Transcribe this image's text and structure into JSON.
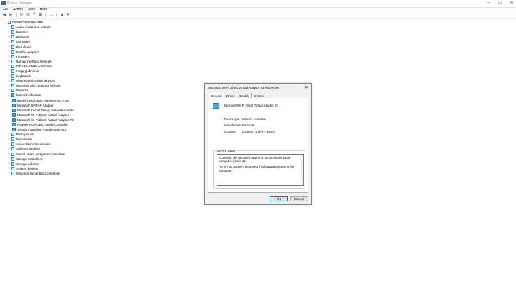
{
  "window": {
    "title": "Device Manager",
    "controls": [
      "–",
      "☐",
      "✕"
    ]
  },
  "menu": [
    "File",
    "Action",
    "View",
    "Help"
  ],
  "toolbar_icons": [
    "back-icon",
    "forward-icon",
    "properties-icon",
    "help-icon",
    "scan-icon",
    "monitor-icon",
    "update-driver-icon",
    "uninstall-icon"
  ],
  "tree": {
    "root": "DESKTOP-RQ0A2PM",
    "categories": [
      "Audio inputs and outputs",
      "Batteries",
      "Bluetooth",
      "Computer",
      "Disk drives",
      "Display adapters",
      "Firmware",
      "Human Interface Devices",
      "IDE ATA/ATAPI controllers",
      "Imaging devices",
      "Keyboards",
      "Memory technology devices",
      "Mice and other pointing devices",
      "Monitors"
    ],
    "expanded": "Network adapters",
    "network_adapters": [
      "Intel(R) Dual Band Wireless-AC 7260",
      "Microsoft ISATAP Adapter",
      "Microsoft Kernel Debug Network Adapter",
      "Microsoft Wi-Fi Direct Virtual Adapter",
      "Microsoft Wi-Fi Direct Virtual Adapter #2",
      "Realtek PCIe GBE Family Controller",
      "Teredo Tunneling Pseudo-Interface"
    ],
    "categories_after": [
      "Print queues",
      "Processors",
      "secure biometric devices",
      "Software devices",
      "Sound, video and game controllers",
      "Storage controllers",
      "Storage volumes",
      "System devices",
      "Universal Serial Bus controllers"
    ]
  },
  "dialog": {
    "title": "Microsoft Wi-Fi Direct Virtual Adapter #2 Properties",
    "tabs": [
      "General",
      "Driver",
      "Details",
      "Events"
    ],
    "device_name": "Microsoft Wi-Fi Direct Virtual Adapter #2",
    "props": [
      {
        "label": "Device type:",
        "value": "Network adapters"
      },
      {
        "label": "Manufacturer:",
        "value": "Microsoft"
      },
      {
        "label": "Location:",
        "value": "Location 11 (Wi-Fi Bus 0)"
      }
    ],
    "status_label": "Device status",
    "status_text_1": "Currently, this hardware device is not connected to the computer. (Code 45)",
    "status_text_2": "To fix this problem, reconnect this hardware device to the computer.",
    "ok_label": "OK",
    "cancel_label": "Cancel"
  },
  "colors": {
    "accent": "#0078d7",
    "icon_blue": "#55a5d8"
  }
}
